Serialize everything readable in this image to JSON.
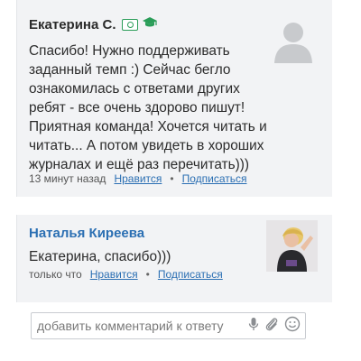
{
  "comments": [
    {
      "author": "Екатерина С.",
      "text": "Спасибо! Нужно поддерживать заданный темп :) Сейчас бегло ознакомилась с ответами других ребят - все очень здорово пишут! Приятная команда! Хочется читать и читать... А потом увидеть в хороших журналах и ещё раз перечитать)))",
      "time": "13 минут назад",
      "like_label": "Нравится",
      "subscribe_label": "Подписаться",
      "separator": "•"
    },
    {
      "author": "Наталья Киреева",
      "text": "Екатерина, спасибо)))",
      "time": "только что",
      "like_label": "Нравится",
      "subscribe_label": "Подписаться",
      "separator": "•"
    }
  ],
  "comment_input": {
    "placeholder": "добавить комментарий к ответу"
  },
  "icons": {
    "money_badge": "money-badge-icon",
    "cap_badge": "graduation-cap-icon",
    "mic": "microphone-icon",
    "attach": "paperclip-icon",
    "emoji": "smiley-icon",
    "avatar_placeholder": "user-silhouette-icon"
  },
  "colors": {
    "link": "#2b6fb3",
    "badge_green": "#2a9d58",
    "card_bg": "#f2f3f5"
  }
}
